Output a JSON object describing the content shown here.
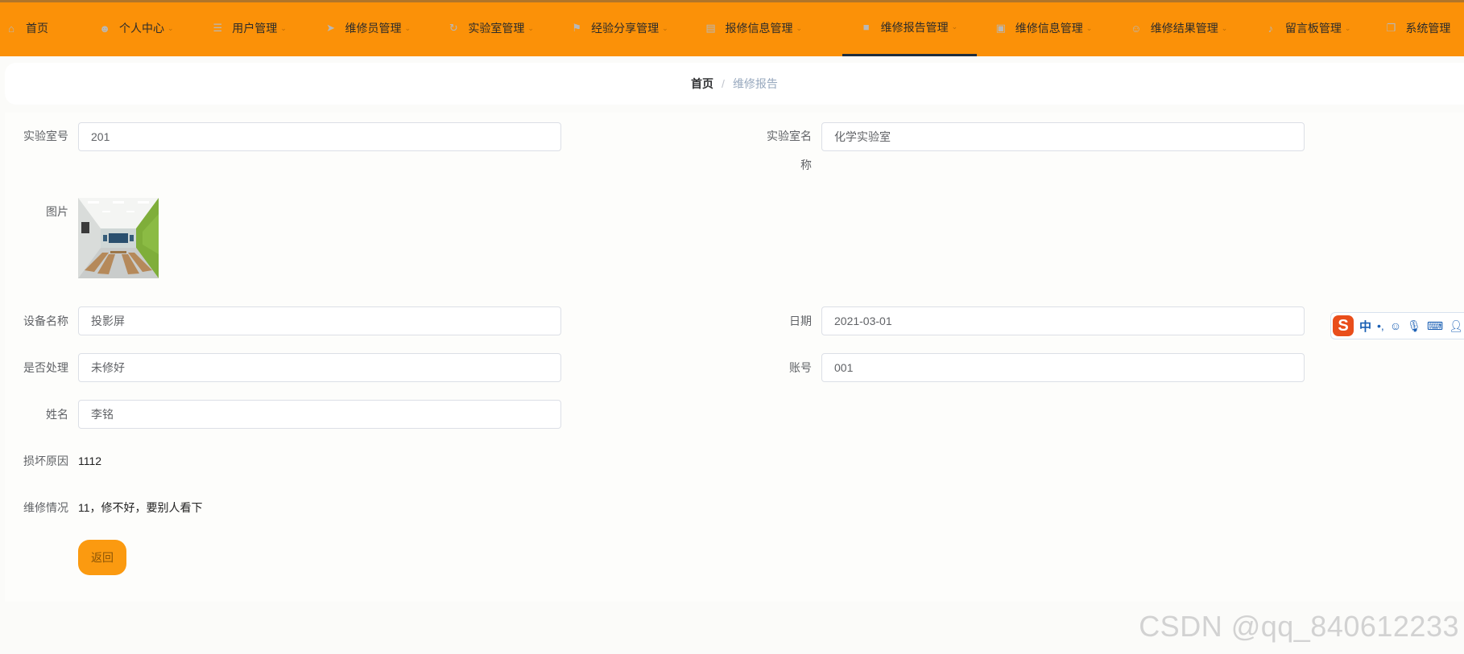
{
  "nav": {
    "items": [
      {
        "label": "首页",
        "icon": "home-icon",
        "glyph": "⌂",
        "has_chevron": false
      },
      {
        "label": "个人中心",
        "icon": "user-icon",
        "glyph": "☻",
        "has_chevron": true
      },
      {
        "label": "用户管理",
        "icon": "list-icon",
        "glyph": "☰",
        "has_chevron": true
      },
      {
        "label": "维修员管理",
        "icon": "paper-plane-icon",
        "glyph": "➤",
        "has_chevron": true
      },
      {
        "label": "实验室管理",
        "icon": "refresh-icon",
        "glyph": "↻",
        "has_chevron": true
      },
      {
        "label": "经验分享管理",
        "icon": "flag-icon",
        "glyph": "⚑",
        "has_chevron": true
      },
      {
        "label": "报修信息管理",
        "icon": "document-icon",
        "glyph": "▤",
        "has_chevron": true
      },
      {
        "label": "维修报告管理",
        "icon": "video-icon",
        "glyph": "■",
        "has_chevron": true,
        "active": true
      },
      {
        "label": "维修信息管理",
        "icon": "picture-icon",
        "glyph": "▣",
        "has_chevron": true
      },
      {
        "label": "维修结果管理",
        "icon": "person-icon",
        "glyph": "☺",
        "has_chevron": true
      },
      {
        "label": "留言板管理",
        "icon": "microphone-icon",
        "glyph": "♪",
        "has_chevron": true
      },
      {
        "label": "系统管理",
        "icon": "copy-icon",
        "glyph": "❐",
        "has_chevron": false
      }
    ]
  },
  "breadcrumb": {
    "home": "首页",
    "separator": "/",
    "current": "维修报告"
  },
  "form": {
    "lab_no_label": "实验室号",
    "lab_no_value": "201",
    "lab_name_label_1": "实验室名",
    "lab_name_label_2": "称",
    "lab_name_value": "化学实验室",
    "image_label": "图片",
    "device_label": "设备名称",
    "device_value": "投影屏",
    "date_label": "日期",
    "date_value": "2021-03-01",
    "handled_label": "是否处理",
    "handled_value": "未修好",
    "account_label": "账号",
    "account_value": "001",
    "name_label": "姓名",
    "name_value": "李铭",
    "damage_label": "损坏原因",
    "damage_value": "1112",
    "repair_label": "维修情况",
    "repair_value": "11，修不好，要别人看下",
    "back_label": "返回"
  },
  "ime": {
    "logo": "S",
    "mode": "中",
    "punct": "•,",
    "icons": [
      "smiley-icon",
      "microphone-icon",
      "keyboard-icon",
      "user-icon"
    ]
  },
  "watermark": "CSDN @qq_840612233",
  "colors": {
    "nav_bg": "#fb9108",
    "button_bg": "#fb9a10",
    "active_underline": "#1f2d3d"
  }
}
